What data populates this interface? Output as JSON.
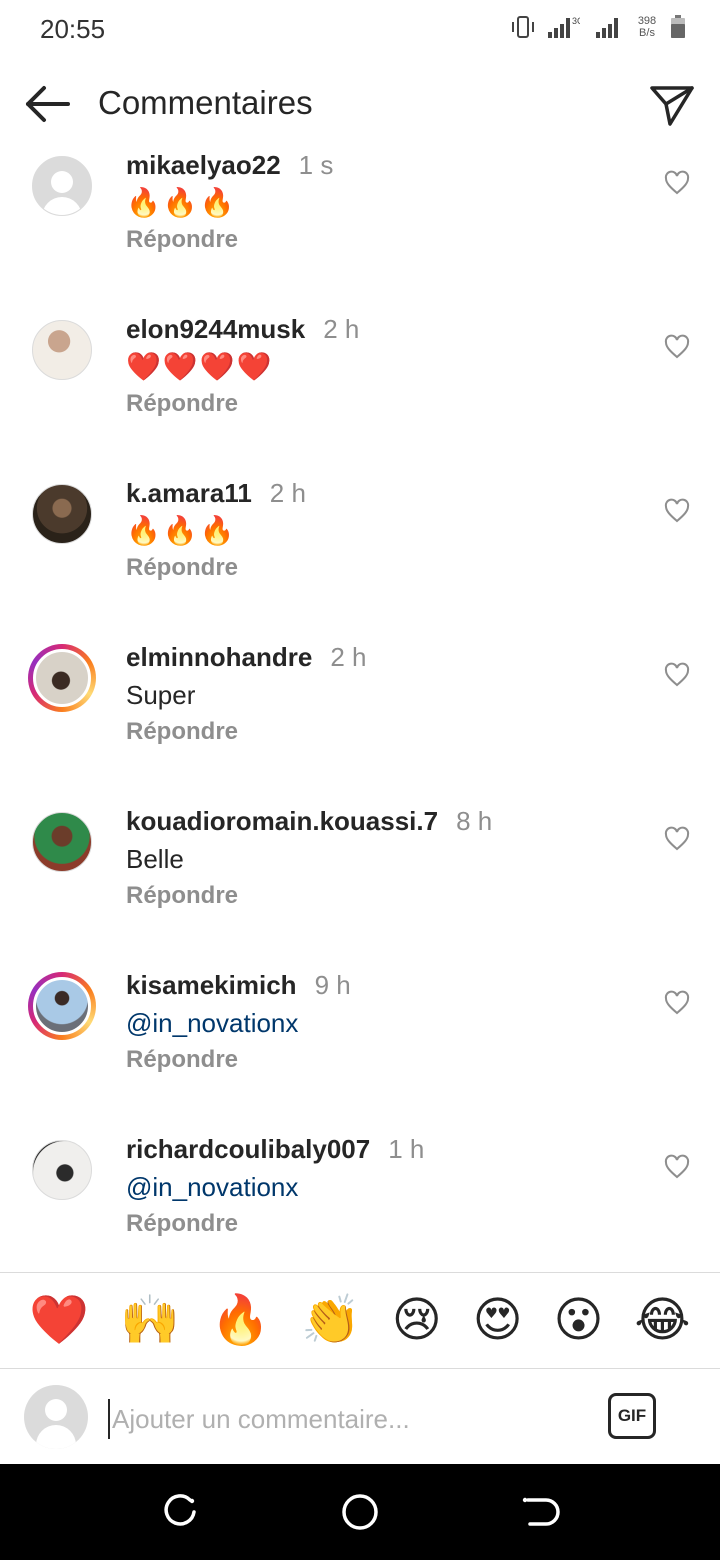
{
  "status_bar": {
    "time": "20:55",
    "network_type": "3G",
    "speed_value": "398",
    "speed_unit": "B/s"
  },
  "header": {
    "title": "Commentaires"
  },
  "comments": [
    {
      "username": "mikaelyao22",
      "time": "1 s",
      "text": "🔥🔥🔥",
      "reply": "Répondre"
    },
    {
      "username": "elon9244musk",
      "time": "2 h",
      "text": "❤️❤️❤️❤️",
      "reply": "Répondre"
    },
    {
      "username": "k.amara11",
      "time": "2 h",
      "text": "🔥🔥🔥",
      "reply": "Répondre"
    },
    {
      "username": "elminnohandre",
      "time": "2 h",
      "text": "Super",
      "reply": "Répondre"
    },
    {
      "username": "kouadioromain.kouassi.7",
      "time": "8 h",
      "text": "Belle",
      "reply": "Répondre"
    },
    {
      "username": "kisamekimich",
      "time": "9 h",
      "text": "@in_novationx",
      "reply": "Répondre"
    },
    {
      "username": "richardcoulibaly007",
      "time": "1 h",
      "text": "@in_novationx",
      "reply": "Répondre"
    }
  ],
  "emoji_bar": [
    "❤️",
    "🙌",
    "🔥",
    "👏",
    "😢",
    "😍",
    "😮",
    "😂"
  ],
  "input": {
    "placeholder": "Ajouter un commentaire...",
    "gif_label": "GIF"
  },
  "colors": {
    "mention": "#00376b",
    "muted": "#8e8e8e",
    "text": "#262626"
  },
  "icons": {
    "back": "arrow-left-icon",
    "send": "paper-plane-icon",
    "like": "heart-outline-icon",
    "nav_recent": "recent-apps-icon",
    "nav_home": "home-circle-icon",
    "nav_back": "back-icon"
  }
}
